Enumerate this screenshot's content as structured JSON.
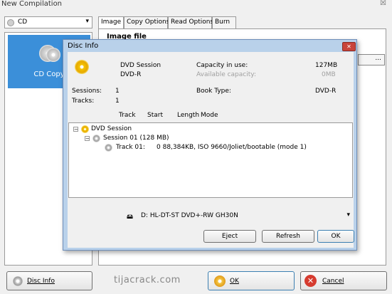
{
  "window": {
    "title": "New Compilation",
    "close_glyph": "☒"
  },
  "source_combo": {
    "value": "CD",
    "icon": "disc-icon"
  },
  "left_pane": {
    "items": [
      {
        "label": "CD Copy",
        "selected": true
      }
    ]
  },
  "tabs": [
    {
      "label": "Image",
      "active": true
    },
    {
      "label": "Copy Options",
      "active": false
    },
    {
      "label": "Read Options",
      "active": false
    },
    {
      "label": "Burn",
      "active": false
    }
  ],
  "image_tab": {
    "image_file_label": "Image file",
    "browse_label": "..."
  },
  "buttons": {
    "disc_info": "Disc Info",
    "ok": "OK",
    "cancel": "Cancel"
  },
  "watermark": "tijacrack.com",
  "dialog": {
    "title": "Disc Info",
    "close_glyph": "✕",
    "media_type": "DVD Session",
    "media_subtype": "DVD-R",
    "capacity_in_use_label": "Capacity in use:",
    "capacity_in_use_value": "127MB",
    "available_capacity_label": "Available capacity:",
    "available_capacity_value": "0MB",
    "sessions_label": "Sessions:",
    "sessions_value": "1",
    "tracks_label": "Tracks:",
    "tracks_value": "1",
    "book_type_label": "Book Type:",
    "book_type_value": "DVD-R",
    "columns": [
      "Track",
      "Start",
      "Length",
      "Mode"
    ],
    "tree": {
      "root": "DVD Session",
      "session": "Session 01 (128 MB)",
      "track_label": "Track 01:",
      "track_info": "0 88,384KB, ISO 9660/Joliet/bootable (mode 1)"
    },
    "drive": "D: HL-DT-ST DVD+-RW GH30N",
    "eject_label": "Eject",
    "refresh_label": "Refresh",
    "ok_label": "OK"
  },
  "colors": {
    "selection": "#3b8fd9",
    "dialog_frame": "#b9d1ea",
    "cancel_red": "#d63b2f"
  }
}
